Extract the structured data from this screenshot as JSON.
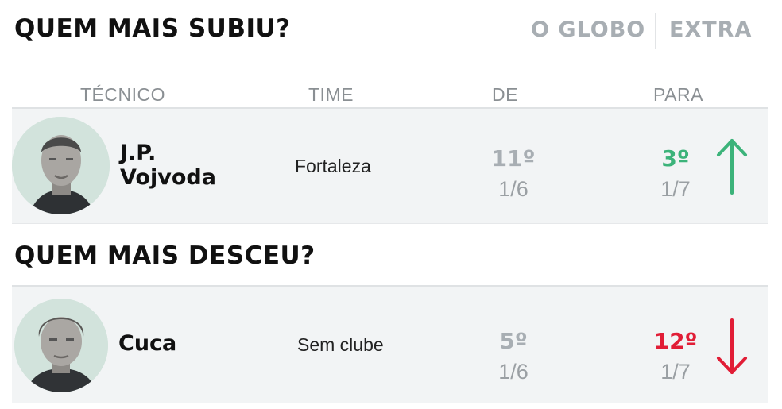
{
  "titles": {
    "up": "QUEM MAIS SUBIU?",
    "down": "QUEM MAIS DESCEU?"
  },
  "brands": {
    "globo": "O GLOBO",
    "extra": "EXTRA"
  },
  "columns": {
    "coach": "TÉCNICO",
    "team": "TIME",
    "from": "DE",
    "to": "PARA"
  },
  "colors": {
    "up": "#3cb37a",
    "down": "#e11d36",
    "muted": "#a8aeb3"
  },
  "rising": {
    "name_line1": "J.P.",
    "name_line2": "Vojvoda",
    "team": "Fortaleza",
    "from_rank": "11º",
    "from_date": "1/6",
    "to_rank": "3º",
    "to_date": "1/7",
    "direction_icon": "arrow-up-icon"
  },
  "falling": {
    "name_line1": "Cuca",
    "team": "Sem clube",
    "from_rank": "5º",
    "from_date": "1/6",
    "to_rank": "12º",
    "to_date": "1/7",
    "direction_icon": "arrow-down-icon"
  }
}
